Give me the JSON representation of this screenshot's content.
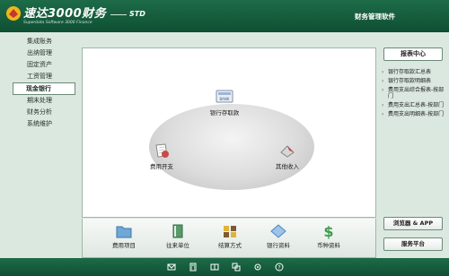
{
  "header": {
    "logo_title": "速达3000财务",
    "logo_subtitle": "Superdata Software 3000 Finance",
    "edition": "STD",
    "app_name": "财务管理软件"
  },
  "left_nav": {
    "items": [
      {
        "label": "集成账务"
      },
      {
        "label": "出纳管理"
      },
      {
        "label": "固定资产"
      },
      {
        "label": "工资管理"
      },
      {
        "label": "现金银行"
      },
      {
        "label": "期末处理"
      },
      {
        "label": "财务分析"
      },
      {
        "label": "系统维护"
      }
    ],
    "active_index": 4
  },
  "flow": {
    "nodes": [
      {
        "label": "银行存取款",
        "icon": "bank-icon"
      },
      {
        "label": "费用开支",
        "icon": "expense-icon"
      },
      {
        "label": "其他收入",
        "icon": "income-icon"
      }
    ]
  },
  "bottom_bar": {
    "items": [
      {
        "label": "费用项目",
        "icon": "folder-icon"
      },
      {
        "label": "往来单位",
        "icon": "book-icon"
      },
      {
        "label": "结算方式",
        "icon": "settlement-icon"
      },
      {
        "label": "银行资料",
        "icon": "diamond-icon"
      },
      {
        "label": "币种资料",
        "icon": "currency-icon"
      }
    ]
  },
  "right_panel": {
    "title": "报表中心",
    "reports": [
      {
        "label": "银行存取款汇总表"
      },
      {
        "label": "银行存取款明细表"
      },
      {
        "label": "费用支出综合报表-按部门"
      },
      {
        "label": "费用支出汇总表-按部门"
      },
      {
        "label": "费用支出明细表-按部门"
      }
    ],
    "browser_button": "浏览器 & APP",
    "service_button": "服务平台"
  },
  "colors": {
    "header": "#1d6b48",
    "background": "#dbe8e0",
    "accent": "#0f4f33"
  }
}
